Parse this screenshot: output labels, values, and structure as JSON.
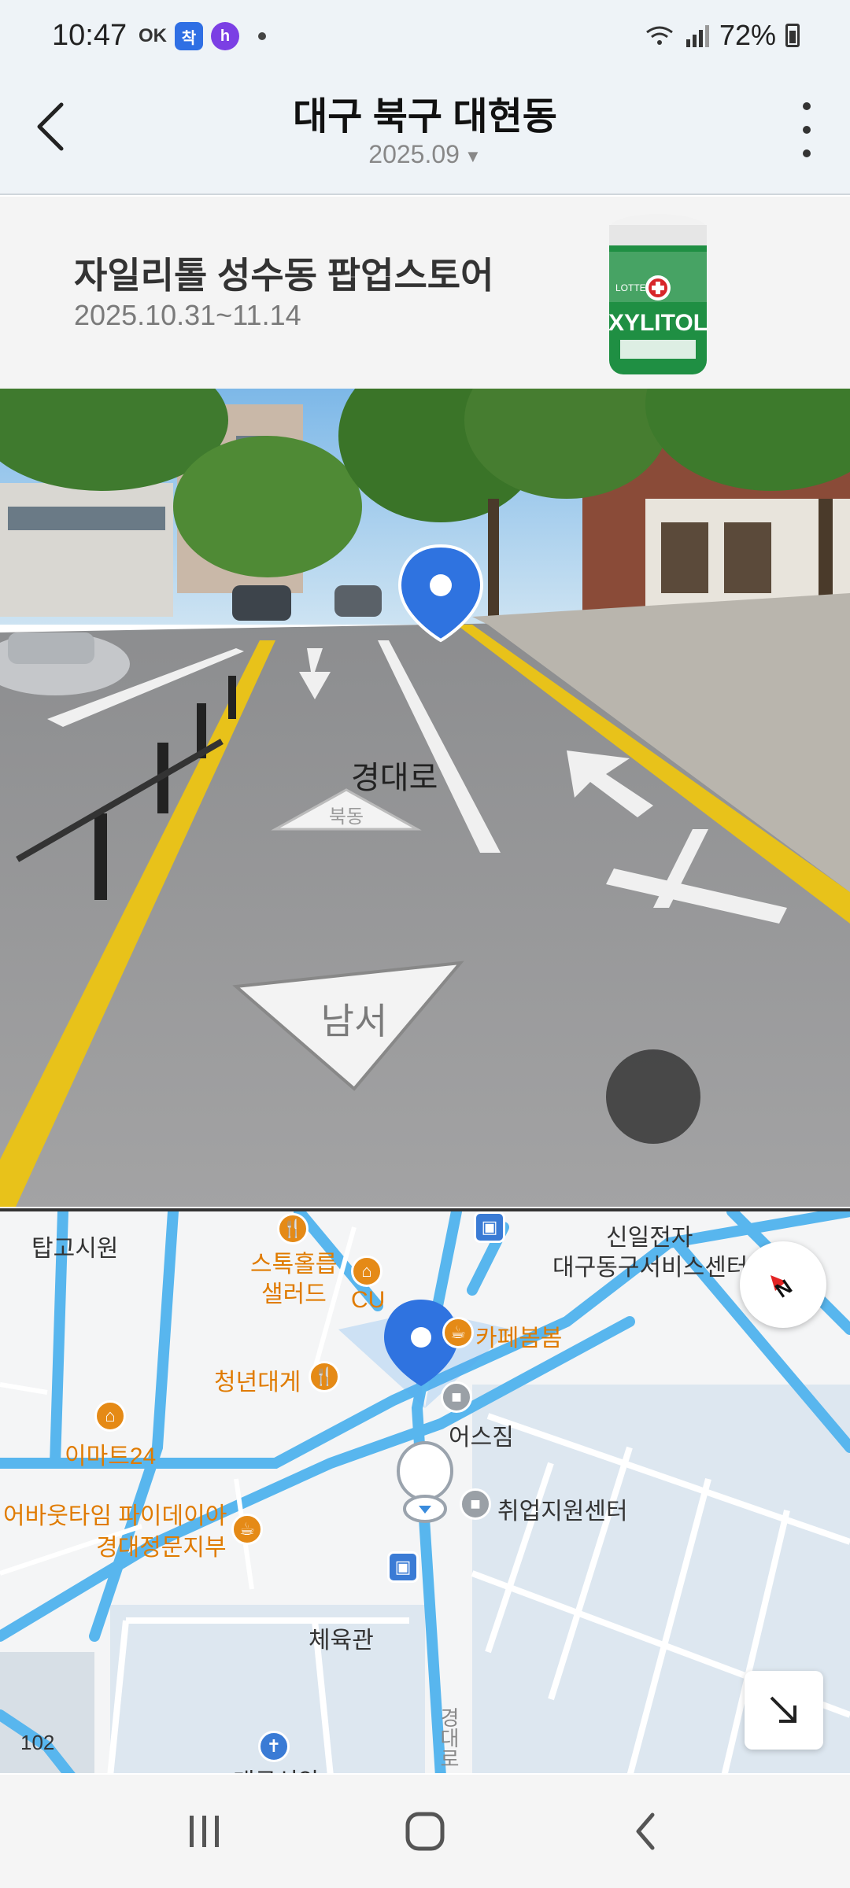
{
  "status_bar": {
    "time": "10:47",
    "ok_label": "OK",
    "badge1": "착",
    "badge2": "h",
    "battery": "72%"
  },
  "header": {
    "title": "대구 북구 대현동",
    "date": "2025.09",
    "icons": [
      "back-arrow-icon",
      "chevron-down-icon",
      "more-vertical-icon"
    ]
  },
  "ad": {
    "title": "자일리톨 성수동 팝업스토어",
    "date_range": "2025.10.31~11.14",
    "product_brand": "XYLITOL",
    "product_maker": "LOTTE"
  },
  "street_view": {
    "road_label": "경대로",
    "arrow_text_1": "북동",
    "arrow_text_2": "남서"
  },
  "map": {
    "labels": {
      "tapgo": "탑고시원",
      "stock_salad_1": "스톡홀릅",
      "stock_salad_2": "샐러드",
      "cu": "CU",
      "shinil_1": "신일전자",
      "shinil_2": "대구동구서비스센터",
      "cafe": "카페봄봄",
      "cheongnyeon": "청년대게",
      "emart": "이마트24",
      "biz": "어스짐",
      "about_1": "어바웃타임 파이데이아",
      "about_2": "경대정문지부",
      "job": "취업지원센터",
      "gym": "체육관",
      "road": "경대로",
      "num": "102",
      "bottom_cut": "대구신암"
    }
  },
  "colors": {
    "header_bg": "#eef3f7",
    "pin_blue": "#2f73e0",
    "road_blue": "#58b6ee",
    "poi_orange": "#e07b00"
  }
}
